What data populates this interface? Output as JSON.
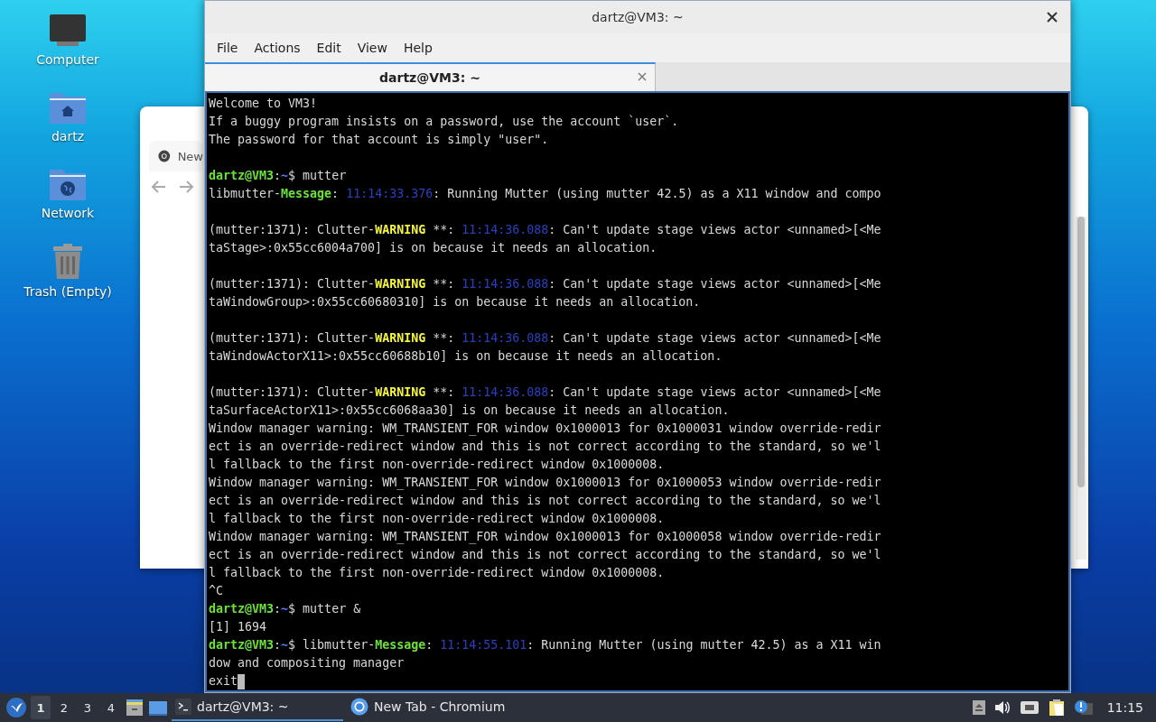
{
  "desktop_icons": [
    {
      "kind": "computer",
      "label": "Computer"
    },
    {
      "kind": "home",
      "label": "dartz"
    },
    {
      "kind": "network",
      "label": "Network"
    },
    {
      "kind": "trash",
      "label": "Trash (Empty)"
    }
  ],
  "browser": {
    "tab_label": "New"
  },
  "terminal": {
    "title": "dartz@VM3: ~",
    "menu": [
      "File",
      "Actions",
      "Edit",
      "View",
      "Help"
    ],
    "tabs": [
      {
        "label": "dartz@VM3: ~",
        "selected": true
      }
    ],
    "blocks": [
      {
        "lines": [
          {
            "segments": [
              {
                "kind": "plain",
                "text": "Welcome to VM3!"
              }
            ]
          },
          {
            "segments": [
              {
                "kind": "plain",
                "text": "If a buggy program insists on a password, use the account `user`."
              }
            ]
          },
          {
            "segments": [
              {
                "kind": "plain",
                "text": "The password for that account is simply \"user\"."
              }
            ]
          }
        ]
      },
      {
        "lines": [
          {
            "segments": [
              {
                "kind": "user",
                "text": "dartz@VM3"
              },
              {
                "kind": "plain",
                "text": ":"
              },
              {
                "kind": "path",
                "text": "~"
              },
              {
                "kind": "plain",
                "text": "$ mutter"
              }
            ]
          },
          {
            "segments": [
              {
                "kind": "plain",
                "text": "libmutter-"
              },
              {
                "kind": "green",
                "text": "Message"
              },
              {
                "kind": "plain",
                "text": ": "
              },
              {
                "kind": "time",
                "text": "11:14:33.376"
              },
              {
                "kind": "plain",
                "text": ": Running Mutter (using mutter 42.5) as a X11 window and compo"
              }
            ]
          }
        ]
      },
      {
        "lines": [
          {
            "segments": [
              {
                "kind": "plain",
                "text": "(mutter:1371): Clutter-"
              },
              {
                "kind": "yellow",
                "text": "WARNING"
              },
              {
                "kind": "plain",
                "text": " **: "
              },
              {
                "kind": "time",
                "text": "11:14:36.088"
              },
              {
                "kind": "plain",
                "text": ": Can't update stage views actor <unnamed>[<Me"
              }
            ]
          },
          {
            "segments": [
              {
                "kind": "plain",
                "text": "taStage>:0x55cc6004a700] is on because it needs an allocation."
              }
            ]
          }
        ]
      },
      {
        "lines": [
          {
            "segments": [
              {
                "kind": "plain",
                "text": "(mutter:1371): Clutter-"
              },
              {
                "kind": "yellow",
                "text": "WARNING"
              },
              {
                "kind": "plain",
                "text": " **: "
              },
              {
                "kind": "time",
                "text": "11:14:36.088"
              },
              {
                "kind": "plain",
                "text": ": Can't update stage views actor <unnamed>[<Me"
              }
            ]
          },
          {
            "segments": [
              {
                "kind": "plain",
                "text": "taWindowGroup>:0x55cc60680310] is on because it needs an allocation."
              }
            ]
          }
        ]
      },
      {
        "lines": [
          {
            "segments": [
              {
                "kind": "plain",
                "text": "(mutter:1371): Clutter-"
              },
              {
                "kind": "yellow",
                "text": "WARNING"
              },
              {
                "kind": "plain",
                "text": " **: "
              },
              {
                "kind": "time",
                "text": "11:14:36.088"
              },
              {
                "kind": "plain",
                "text": ": Can't update stage views actor <unnamed>[<Me"
              }
            ]
          },
          {
            "segments": [
              {
                "kind": "plain",
                "text": "taWindowActorX11>:0x55cc60688b10] is on because it needs an allocation."
              }
            ]
          }
        ]
      },
      {
        "lines": [
          {
            "segments": [
              {
                "kind": "plain",
                "text": "(mutter:1371): Clutter-"
              },
              {
                "kind": "yellow",
                "text": "WARNING"
              },
              {
                "kind": "plain",
                "text": " **: "
              },
              {
                "kind": "time",
                "text": "11:14:36.088"
              },
              {
                "kind": "plain",
                "text": ": Can't update stage views actor <unnamed>[<Me"
              }
            ]
          },
          {
            "segments": [
              {
                "kind": "plain",
                "text": "taSurfaceActorX11>:0x55cc6068aa30] is on because it needs an allocation."
              }
            ]
          },
          {
            "segments": [
              {
                "kind": "plain",
                "text": "Window manager warning: WM_TRANSIENT_FOR window 0x1000013 for 0x1000031 window override-redir"
              }
            ]
          },
          {
            "segments": [
              {
                "kind": "plain",
                "text": "ect is an override-redirect window and this is not correct according to the standard, so we'l"
              }
            ]
          },
          {
            "segments": [
              {
                "kind": "plain",
                "text": "l fallback to the first non-override-redirect window 0x1000008."
              }
            ]
          },
          {
            "segments": [
              {
                "kind": "plain",
                "text": "Window manager warning: WM_TRANSIENT_FOR window 0x1000013 for 0x1000053 window override-redir"
              }
            ]
          },
          {
            "segments": [
              {
                "kind": "plain",
                "text": "ect is an override-redirect window and this is not correct according to the standard, so we'l"
              }
            ]
          },
          {
            "segments": [
              {
                "kind": "plain",
                "text": "l fallback to the first non-override-redirect window 0x1000008."
              }
            ]
          },
          {
            "segments": [
              {
                "kind": "plain",
                "text": "Window manager warning: WM_TRANSIENT_FOR window 0x1000013 for 0x1000058 window override-redir"
              }
            ]
          },
          {
            "segments": [
              {
                "kind": "plain",
                "text": "ect is an override-redirect window and this is not correct according to the standard, so we'l"
              }
            ]
          },
          {
            "segments": [
              {
                "kind": "plain",
                "text": "l fallback to the first non-override-redirect window 0x1000008."
              }
            ]
          },
          {
            "segments": [
              {
                "kind": "plain",
                "text": "^C"
              }
            ]
          },
          {
            "segments": [
              {
                "kind": "user",
                "text": "dartz@VM3"
              },
              {
                "kind": "plain",
                "text": ":"
              },
              {
                "kind": "path",
                "text": "~"
              },
              {
                "kind": "plain",
                "text": "$ mutter &"
              }
            ]
          },
          {
            "segments": [
              {
                "kind": "plain",
                "text": "[1] 1694"
              }
            ]
          },
          {
            "segments": [
              {
                "kind": "user",
                "text": "dartz@VM3"
              },
              {
                "kind": "plain",
                "text": ":"
              },
              {
                "kind": "path",
                "text": "~"
              },
              {
                "kind": "plain",
                "text": "$ libmutter-"
              },
              {
                "kind": "green",
                "text": "Message"
              },
              {
                "kind": "plain",
                "text": ": "
              },
              {
                "kind": "time",
                "text": "11:14:55.101"
              },
              {
                "kind": "plain",
                "text": ": Running Mutter (using mutter 42.5) as a X11 win"
              }
            ]
          },
          {
            "segments": [
              {
                "kind": "plain",
                "text": "dow and compositing manager"
              }
            ]
          },
          {
            "cursor": true,
            "segments": [
              {
                "kind": "plain",
                "text": "exit"
              }
            ]
          }
        ]
      }
    ]
  },
  "taskbar": {
    "workspaces": [
      {
        "label": "1",
        "selected": true
      },
      {
        "label": "2",
        "selected": false
      },
      {
        "label": "3",
        "selected": false
      },
      {
        "label": "4",
        "selected": false
      }
    ],
    "tasks": [
      {
        "kind": "terminal",
        "label": "dartz@VM3: ~",
        "selected": true
      },
      {
        "kind": "browser",
        "label": "New Tab - Chromium",
        "selected": false
      }
    ],
    "clock": "11:15"
  }
}
